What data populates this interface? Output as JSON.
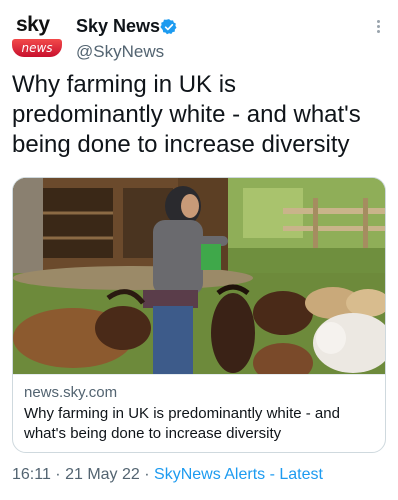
{
  "author": {
    "avatar_top": "sky",
    "avatar_bottom": "news",
    "display_name": "Sky News",
    "handle": "@SkyNews",
    "verified_icon": "verified-badge-icon",
    "brand_color": "#c8102e",
    "verified_color": "#1d9bf0"
  },
  "tweet": {
    "text": "Why farming in UK is predominantly white - and what's being done to increase diversity"
  },
  "card": {
    "domain": "news.sky.com",
    "title": "Why farming in UK is predominantly white - and what's being done to increase diversity"
  },
  "meta": {
    "time": "16:11",
    "date": "21 May 22",
    "separator": " · ",
    "source_app": "SkyNews Alerts - Latest"
  },
  "icons": {
    "more": "more-options-icon"
  }
}
